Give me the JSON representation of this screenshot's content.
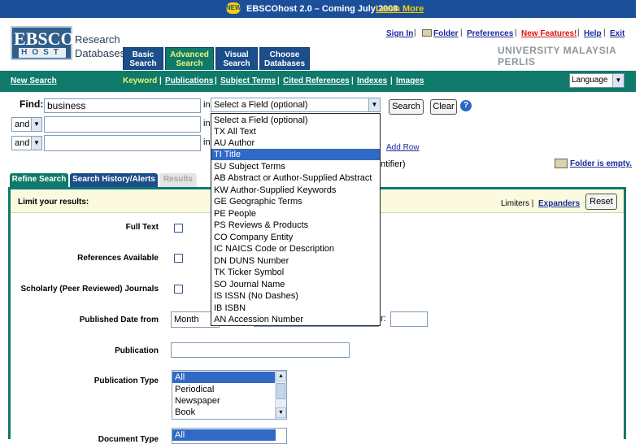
{
  "banner": {
    "badge": "NEW",
    "text": "EBSCOhost 2.0 – Coming July 2008",
    "link": "Learn More"
  },
  "logo": {
    "line1": "EBSCO",
    "line2": "HOST",
    "subtitle1": "Research",
    "subtitle2": "Databases"
  },
  "tabs": [
    {
      "line1": "Basic",
      "line2": "Search"
    },
    {
      "line1": "Advanced",
      "line2": "Search"
    },
    {
      "line1": "Visual",
      "line2": "Search"
    },
    {
      "line1": "Choose",
      "line2": "Databases"
    }
  ],
  "toplinks": {
    "sign_in": "Sign In",
    "folder": "Folder",
    "preferences": "Preferences",
    "new_features": "New Features!",
    "help": "Help",
    "exit": "Exit"
  },
  "institution": "UNIVERSITY MALAYSIA PERLIS",
  "nav": {
    "new_search": "New Search",
    "keyword": "Keyword",
    "publications": "Publications",
    "subject_terms": "Subject Terms",
    "cited_references": "Cited References",
    "indexes": "Indexes",
    "images": "Images",
    "language": "Language"
  },
  "search": {
    "find_label": "Find:",
    "find_value": "business",
    "field_select": "Select a Field (optional)",
    "bool1": "and",
    "bool2": "and",
    "in_label": "in",
    "search_btn": "Search",
    "clear_btn": "Clear",
    "help_icon": "?",
    "add_row": "Add Row",
    "identifier_fragment": "ntifier)"
  },
  "field_options": [
    "Select a Field (optional)",
    "TX All Text",
    "AU Author",
    "TI Title",
    "SU Subject Terms",
    "AB Abstract or Author-Supplied Abstract",
    "KW Author-Supplied Keywords",
    "GE Geographic Terms",
    "PE People",
    "PS Reviews & Products",
    "CO Company Entity",
    "IC NAICS Code or Description",
    "DN DUNS Number",
    "TK Ticker Symbol",
    "SO Journal Name",
    "IS ISSN (No Dashes)",
    "IB ISBN",
    "AN Accession Number"
  ],
  "folder_status": "Folder is empty.",
  "subtabs": {
    "refine": "Refine Search",
    "history": "Search History/Alerts",
    "results": "Results"
  },
  "limits": {
    "title": "Limit your results:",
    "limiters": "Limiters",
    "pipe": "|",
    "expanders": "Expanders",
    "reset": "Reset",
    "full_text": "Full Text",
    "references": "References Available",
    "scholarly": "Scholarly (Peer Reviewed) Journals",
    "published_date": "Published Date from",
    "month": "Month",
    "year_fragment": "r:",
    "publication": "Publication",
    "publication_type": "Publication Type",
    "document_type": "Document Type"
  },
  "publication_types": [
    "All",
    "Periodical",
    "Newspaper",
    "Book"
  ],
  "document_types": [
    "All"
  ]
}
